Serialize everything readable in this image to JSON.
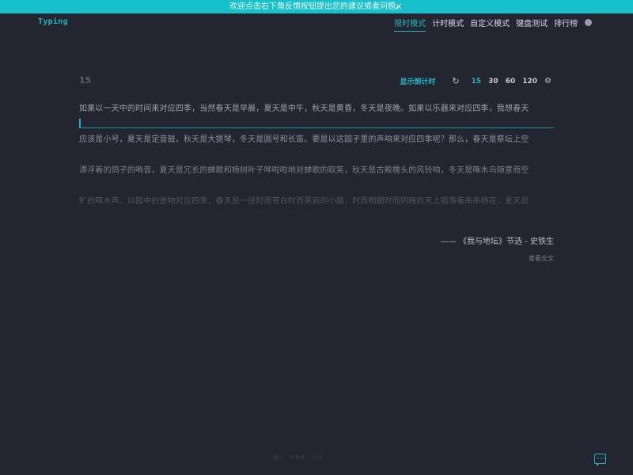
{
  "banner": {
    "text": "欢迎点击右下角反馈按钮提出您的建议或者问题。",
    "close": "✕"
  },
  "logo": "Typing",
  "nav": {
    "items": [
      "限时模式",
      "计时模式",
      "自定义模式",
      "键盘测试",
      "排行榜"
    ],
    "active_index": 0,
    "settings_icon": "gear-icon",
    "avatar_icon": "user-avatar"
  },
  "practice": {
    "countdown_value": "15",
    "show_countdown_label": "显示倒计时",
    "reload_icon": "reload-icon",
    "time_options": [
      "15",
      "30",
      "60",
      "120"
    ],
    "active_option": "15",
    "settings_icon": "gear-icon"
  },
  "passage": {
    "lines": [
      "如果以一天中的时间来对应四季，当然春天是早晨，夏天是中午，秋天是黄昏，冬天是夜晚。如果以乐器来对应四季，我想春天",
      "应该是小号，夏天是定音鼓，秋天是大提琴，冬天是圆号和长笛。要是以这园子里的声响来对应四季呢？那么，春天是祭坛上空",
      "漂浮着的鸽子的哨音，夏天是冗长的蝉歌和杨树叶子哗啦啦地对蝉歌的取笑，秋天是古殿檐头的风铃响，冬天是啄木鸟随意而空",
      "旷的啄木声。以园中的景物对应四季，春天是一径时而苍白时而黑润的小路，时而明朗时而阴晦的天上摇荡着串串杨花；夏天是"
    ],
    "source": "—— 《我与地坛》节选 - 史铁生",
    "full_text_link": "查看全文"
  },
  "footer": {
    "items": [
      "源码",
      "作者博",
      "小站"
    ]
  },
  "feedback_icon": "chat-icon",
  "colors": {
    "accent": "#1fb4be",
    "banner": "#17c1cb",
    "background": "#232530"
  }
}
